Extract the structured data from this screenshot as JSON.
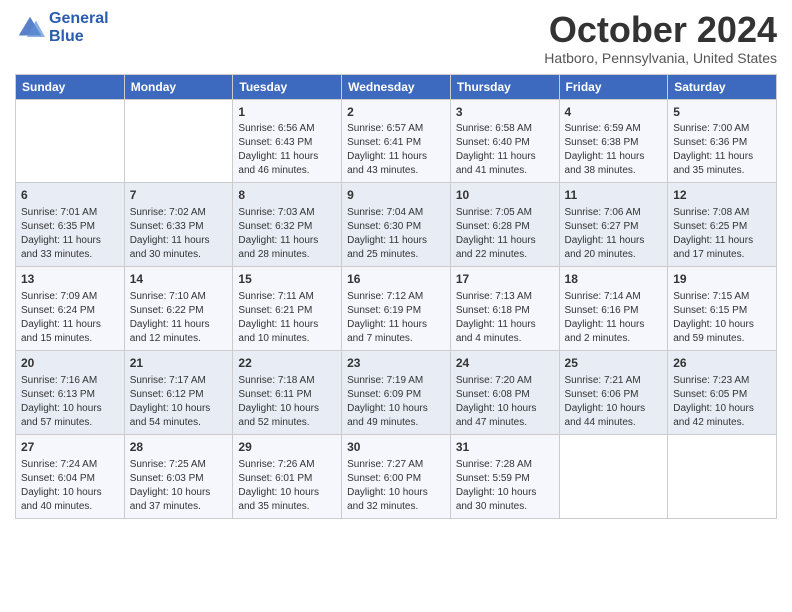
{
  "header": {
    "logo_line1": "General",
    "logo_line2": "Blue",
    "title": "October 2024",
    "location": "Hatboro, Pennsylvania, United States"
  },
  "weekdays": [
    "Sunday",
    "Monday",
    "Tuesday",
    "Wednesday",
    "Thursday",
    "Friday",
    "Saturday"
  ],
  "weeks": [
    [
      {
        "day": "",
        "info": ""
      },
      {
        "day": "",
        "info": ""
      },
      {
        "day": "1",
        "info": "Sunrise: 6:56 AM\nSunset: 6:43 PM\nDaylight: 11 hours and 46 minutes."
      },
      {
        "day": "2",
        "info": "Sunrise: 6:57 AM\nSunset: 6:41 PM\nDaylight: 11 hours and 43 minutes."
      },
      {
        "day": "3",
        "info": "Sunrise: 6:58 AM\nSunset: 6:40 PM\nDaylight: 11 hours and 41 minutes."
      },
      {
        "day": "4",
        "info": "Sunrise: 6:59 AM\nSunset: 6:38 PM\nDaylight: 11 hours and 38 minutes."
      },
      {
        "day": "5",
        "info": "Sunrise: 7:00 AM\nSunset: 6:36 PM\nDaylight: 11 hours and 35 minutes."
      }
    ],
    [
      {
        "day": "6",
        "info": "Sunrise: 7:01 AM\nSunset: 6:35 PM\nDaylight: 11 hours and 33 minutes."
      },
      {
        "day": "7",
        "info": "Sunrise: 7:02 AM\nSunset: 6:33 PM\nDaylight: 11 hours and 30 minutes."
      },
      {
        "day": "8",
        "info": "Sunrise: 7:03 AM\nSunset: 6:32 PM\nDaylight: 11 hours and 28 minutes."
      },
      {
        "day": "9",
        "info": "Sunrise: 7:04 AM\nSunset: 6:30 PM\nDaylight: 11 hours and 25 minutes."
      },
      {
        "day": "10",
        "info": "Sunrise: 7:05 AM\nSunset: 6:28 PM\nDaylight: 11 hours and 22 minutes."
      },
      {
        "day": "11",
        "info": "Sunrise: 7:06 AM\nSunset: 6:27 PM\nDaylight: 11 hours and 20 minutes."
      },
      {
        "day": "12",
        "info": "Sunrise: 7:08 AM\nSunset: 6:25 PM\nDaylight: 11 hours and 17 minutes."
      }
    ],
    [
      {
        "day": "13",
        "info": "Sunrise: 7:09 AM\nSunset: 6:24 PM\nDaylight: 11 hours and 15 minutes."
      },
      {
        "day": "14",
        "info": "Sunrise: 7:10 AM\nSunset: 6:22 PM\nDaylight: 11 hours and 12 minutes."
      },
      {
        "day": "15",
        "info": "Sunrise: 7:11 AM\nSunset: 6:21 PM\nDaylight: 11 hours and 10 minutes."
      },
      {
        "day": "16",
        "info": "Sunrise: 7:12 AM\nSunset: 6:19 PM\nDaylight: 11 hours and 7 minutes."
      },
      {
        "day": "17",
        "info": "Sunrise: 7:13 AM\nSunset: 6:18 PM\nDaylight: 11 hours and 4 minutes."
      },
      {
        "day": "18",
        "info": "Sunrise: 7:14 AM\nSunset: 6:16 PM\nDaylight: 11 hours and 2 minutes."
      },
      {
        "day": "19",
        "info": "Sunrise: 7:15 AM\nSunset: 6:15 PM\nDaylight: 10 hours and 59 minutes."
      }
    ],
    [
      {
        "day": "20",
        "info": "Sunrise: 7:16 AM\nSunset: 6:13 PM\nDaylight: 10 hours and 57 minutes."
      },
      {
        "day": "21",
        "info": "Sunrise: 7:17 AM\nSunset: 6:12 PM\nDaylight: 10 hours and 54 minutes."
      },
      {
        "day": "22",
        "info": "Sunrise: 7:18 AM\nSunset: 6:11 PM\nDaylight: 10 hours and 52 minutes."
      },
      {
        "day": "23",
        "info": "Sunrise: 7:19 AM\nSunset: 6:09 PM\nDaylight: 10 hours and 49 minutes."
      },
      {
        "day": "24",
        "info": "Sunrise: 7:20 AM\nSunset: 6:08 PM\nDaylight: 10 hours and 47 minutes."
      },
      {
        "day": "25",
        "info": "Sunrise: 7:21 AM\nSunset: 6:06 PM\nDaylight: 10 hours and 44 minutes."
      },
      {
        "day": "26",
        "info": "Sunrise: 7:23 AM\nSunset: 6:05 PM\nDaylight: 10 hours and 42 minutes."
      }
    ],
    [
      {
        "day": "27",
        "info": "Sunrise: 7:24 AM\nSunset: 6:04 PM\nDaylight: 10 hours and 40 minutes."
      },
      {
        "day": "28",
        "info": "Sunrise: 7:25 AM\nSunset: 6:03 PM\nDaylight: 10 hours and 37 minutes."
      },
      {
        "day": "29",
        "info": "Sunrise: 7:26 AM\nSunset: 6:01 PM\nDaylight: 10 hours and 35 minutes."
      },
      {
        "day": "30",
        "info": "Sunrise: 7:27 AM\nSunset: 6:00 PM\nDaylight: 10 hours and 32 minutes."
      },
      {
        "day": "31",
        "info": "Sunrise: 7:28 AM\nSunset: 5:59 PM\nDaylight: 10 hours and 30 minutes."
      },
      {
        "day": "",
        "info": ""
      },
      {
        "day": "",
        "info": ""
      }
    ]
  ]
}
